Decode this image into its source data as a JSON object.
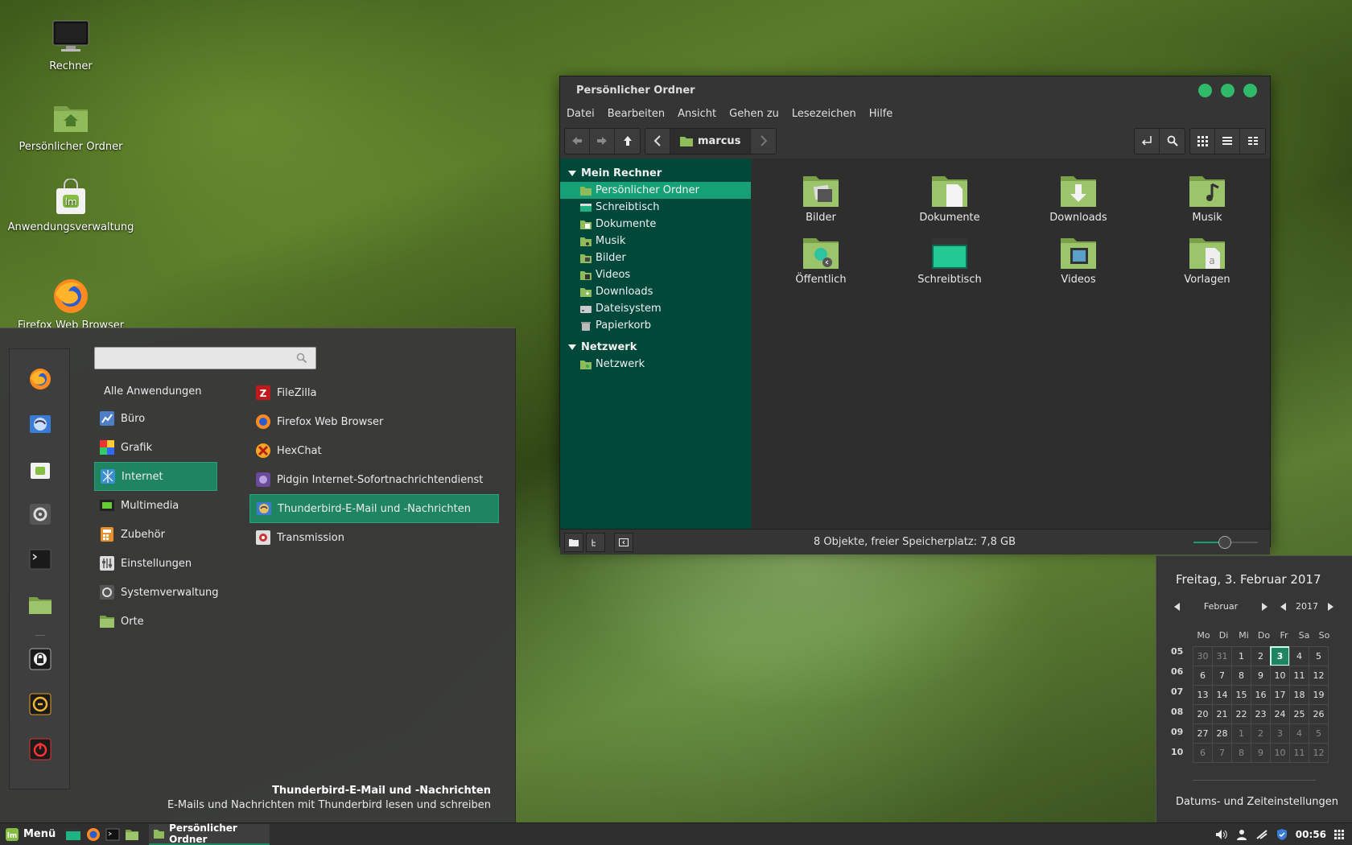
{
  "desktop": {
    "icons": [
      {
        "label": "Rechner",
        "icon": "computer-icon"
      },
      {
        "label": "Persönlicher Ordner",
        "icon": "home-folder-icon"
      },
      {
        "label": "Anwendungsverwaltung",
        "icon": "software-manager-icon"
      },
      {
        "label": "Firefox Web Browser",
        "icon": "firefox-icon"
      }
    ]
  },
  "file_manager": {
    "title": "Persönlicher Ordner",
    "menu": [
      "Datei",
      "Bearbeiten",
      "Ansicht",
      "Gehen zu",
      "Lesezeichen",
      "Hilfe"
    ],
    "path": "marcus",
    "sidebar": {
      "section1": "Mein Rechner",
      "items1": [
        "Persönlicher Ordner",
        "Schreibtisch",
        "Dokumente",
        "Musik",
        "Bilder",
        "Videos",
        "Downloads",
        "Dateisystem",
        "Papierkorb"
      ],
      "section2": "Netzwerk",
      "items2": [
        "Netzwerk"
      ]
    },
    "files": [
      "Bilder",
      "Dokumente",
      "Downloads",
      "Musik",
      "Öffentlich",
      "Schreibtisch",
      "Videos",
      "Vorlagen"
    ],
    "status": "8 Objekte, freier Speicherplatz: 7,8 GB",
    "accent": "#16a076"
  },
  "menu": {
    "search_placeholder": "",
    "categories": [
      "Alle Anwendungen",
      "Büro",
      "Grafik",
      "Internet",
      "Multimedia",
      "Zubehör",
      "Einstellungen",
      "Systemverwaltung",
      "Orte"
    ],
    "selected_category": "Internet",
    "apps": [
      "FileZilla",
      "Firefox Web Browser",
      "HexChat",
      "Pidgin Internet-Sofortnachrichtendienst",
      "Thunderbird-E-Mail und -Nachrichten",
      "Transmission"
    ],
    "selected_app": "Thunderbird-E-Mail und -Nachrichten",
    "desc_title": "Thunderbird-E-Mail und -Nachrichten",
    "desc_text": "E-Mails und Nachrichten mit Thunderbird lesen und schreiben"
  },
  "calendar": {
    "date_label": "Freitag,  3. Februar 2017",
    "month": "Februar",
    "year": "2017",
    "weekdays": [
      "Mo",
      "Di",
      "Mi",
      "Do",
      "Fr",
      "Sa",
      "So"
    ],
    "weeks": [
      "05",
      "06",
      "07",
      "08",
      "09",
      "10"
    ],
    "days": [
      [
        "30",
        "31",
        "1",
        "2",
        "3",
        "4",
        "5"
      ],
      [
        "6",
        "7",
        "8",
        "9",
        "10",
        "11",
        "12"
      ],
      [
        "13",
        "14",
        "15",
        "16",
        "17",
        "18",
        "19"
      ],
      [
        "20",
        "21",
        "22",
        "23",
        "24",
        "25",
        "26"
      ],
      [
        "27",
        "28",
        "1",
        "2",
        "3",
        "4",
        "5"
      ],
      [
        "6",
        "7",
        "8",
        "9",
        "10",
        "11",
        "12"
      ]
    ],
    "today": "3",
    "settings": "Datums- und Zeiteinstellungen"
  },
  "taskbar": {
    "menu_label": "Menü",
    "window_label": "Persönlicher Ordner",
    "clock": "00:56"
  }
}
